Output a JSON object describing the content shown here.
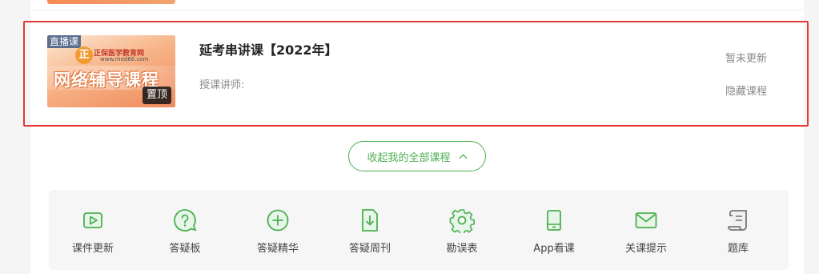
{
  "colors": {
    "accent_green": "#4caf50",
    "highlight_red": "#e53935",
    "muted_text": "#8a8a8a"
  },
  "course": {
    "badge_live": "直播课",
    "badge_pinned": "置顶",
    "thumbnail_logo_text": "正保医学教育网",
    "thumbnail_url": "www.med66.com",
    "thumbnail_banner": "网络辅导课程",
    "title": "延考串讲课【2022年】",
    "teacher_label": "授课讲师:",
    "status": "暂未更新",
    "hide_label": "隐藏课程"
  },
  "collapse_button": {
    "label": "收起我的全部课程",
    "icon": "chevron-up-icon"
  },
  "toolbar": {
    "items": [
      {
        "label": "课件更新",
        "icon": "video-play-icon"
      },
      {
        "label": "答疑板",
        "icon": "question-bubble-icon"
      },
      {
        "label": "答疑精华",
        "icon": "plus-circle-icon"
      },
      {
        "label": "答疑周刊",
        "icon": "download-doc-icon"
      },
      {
        "label": "勘误表",
        "icon": "gear-icon"
      },
      {
        "label": "App看课",
        "icon": "tablet-icon"
      },
      {
        "label": "关课提示",
        "icon": "mail-icon"
      },
      {
        "label": "题库",
        "icon": "scroll-icon"
      }
    ]
  }
}
